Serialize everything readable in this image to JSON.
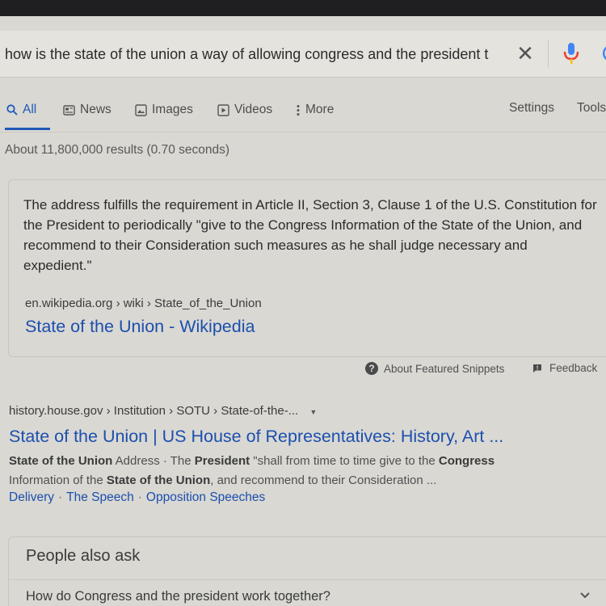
{
  "search": {
    "query": "how is the state of the union a way of allowing congress and the president t",
    "clear_icon": "close-icon",
    "mic_icon": "microphone-icon",
    "brand_colors": {
      "blue": "#4285f4",
      "red": "#ea4335"
    }
  },
  "tabs": [
    {
      "label": "All",
      "icon": "search-icon",
      "active": true
    },
    {
      "label": "News",
      "icon": "news-icon"
    },
    {
      "label": "Images",
      "icon": "image-icon"
    },
    {
      "label": "Videos",
      "icon": "video-icon"
    },
    {
      "label": "More",
      "icon": "more-vert-icon"
    }
  ],
  "tools": {
    "settings": "Settings",
    "tools": "Tools"
  },
  "stats": "About 11,800,000 results (0.70 seconds)",
  "featured_snippet": {
    "text": "The address fulfills the requirement in Article II, Section 3, Clause 1 of the U.S. Constitution for the President to periodically \"give to the Congress Information of the State of the Union, and recommend to their Consideration such measures as he shall judge necessary and expedient.\"",
    "source_crumb": "en.wikipedia.org › wiki › State_of_the_Union",
    "title": "State of the Union - Wikipedia"
  },
  "snippet_footer": {
    "about": "About Featured Snippets",
    "feedback": "Feedback"
  },
  "result": {
    "crumb": "history.house.gov › Institution › SOTU › State-of-the-...",
    "title": "State of the Union | US House of Representatives: History, Art ...",
    "desc": {
      "p1": "State of the Union",
      "p2": " Address · The ",
      "p3": "President",
      "p4": " \"shall from time to time give to the ",
      "p5": "Congress",
      "p6": "Information of the ",
      "p7": "State of the Union",
      "p8": ", and recommend to their Consideration ..."
    },
    "sitelinks": [
      "Delivery",
      "The Speech",
      "Opposition Speeches"
    ],
    "sitelink_sep": "·"
  },
  "people_also_ask": {
    "title": "People also ask",
    "questions": [
      "How do Congress and the president work together?"
    ]
  },
  "colors": {
    "link": "#1c4fae",
    "active_tab": "#1f58b8",
    "background": "#d9d8d3"
  }
}
